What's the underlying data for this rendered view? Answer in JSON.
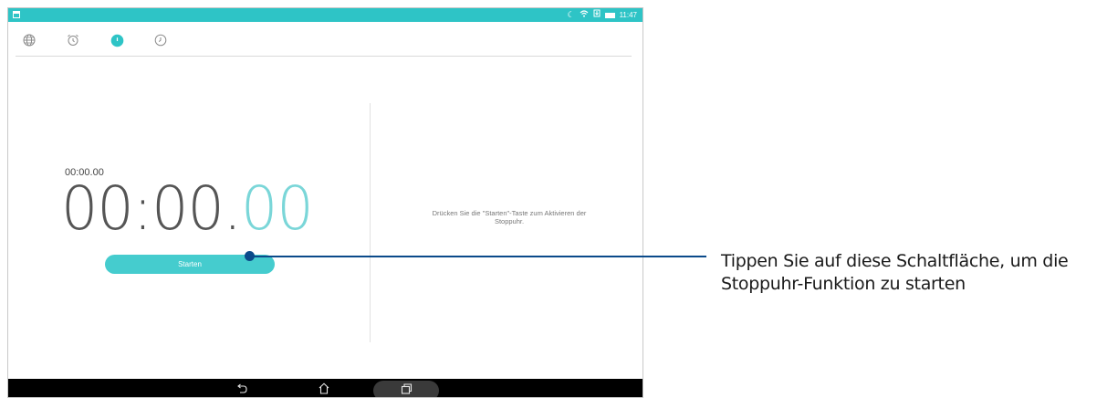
{
  "status_bar": {
    "time": "11:47",
    "icons": [
      "moon-icon",
      "wifi-icon",
      "download-icon",
      "battery-icon"
    ]
  },
  "tabs": [
    {
      "name": "world-clock",
      "icon": "globe-icon",
      "active": false
    },
    {
      "name": "alarm",
      "icon": "alarm-clock-icon",
      "active": false
    },
    {
      "name": "stopwatch",
      "icon": "stopwatch-icon",
      "active": true
    },
    {
      "name": "timer",
      "icon": "timer-icon",
      "active": false
    }
  ],
  "stopwatch": {
    "lap_time": "00:00.00",
    "time_main": "00:00.",
    "time_fraction": "00",
    "start_label": "Starten",
    "hint_line1": "Drücken Sie die \"Starten\"-Taste zum Aktivieren der",
    "hint_line2": "Stoppuhr."
  },
  "navigation": {
    "back_icon": "back-icon",
    "home_icon": "home-icon",
    "recents_icon": "recent-apps-icon"
  },
  "callout": {
    "line1": "Tippen Sie auf diese Schaltfläche, um die",
    "line2": "Stoppuhr-Funktion zu starten"
  },
  "colors": {
    "accent": "#2ec4c6",
    "button": "#45ccce",
    "callout": "#0b4a8a",
    "fraction": "#7ad6d8"
  }
}
